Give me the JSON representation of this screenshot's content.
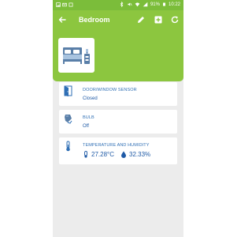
{
  "status_bar": {
    "battery": "91%",
    "time": "10:22"
  },
  "header": {
    "title": "Bedroom"
  },
  "devices": [
    {
      "title": "DOOR/WINDOW SENSOR",
      "value": "Closed",
      "icon": "door-sensor-icon"
    },
    {
      "title": "BULB",
      "value": "Off",
      "icon": "bulb-icon"
    },
    {
      "title": "TEMPERATURE AND HUMIDITY",
      "temperature": "27.28°C",
      "humidity": "32.33%",
      "icon": "thermometer-icon"
    }
  ],
  "colors": {
    "accent": "#8cc63f",
    "status_bar": "#7bbd3a",
    "text_blue": "#1f5aa6",
    "background": "#ececec"
  }
}
